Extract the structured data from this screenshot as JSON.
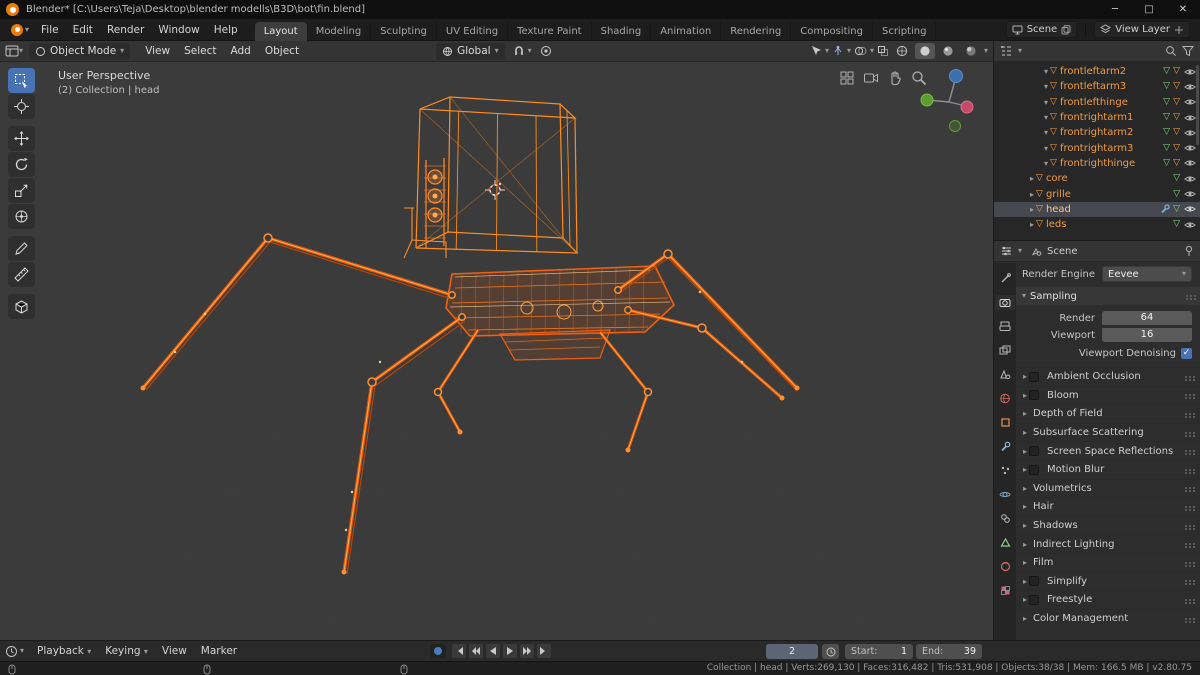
{
  "colors": {
    "accent_blue": "#4772b3",
    "selection_orange": "#f09a45",
    "wire_orange": "#ea5a08",
    "header_gray": "#343434"
  },
  "titlebar": {
    "title": "Blender* [C:\\Users\\Teja\\Desktop\\blender modells\\B3D\\bot\\fin.blend]"
  },
  "topbar": {
    "menus": [
      "File",
      "Edit",
      "Render",
      "Window",
      "Help"
    ],
    "workspaces": [
      "Layout",
      "Modeling",
      "Sculpting",
      "UV Editing",
      "Texture Paint",
      "Shading",
      "Animation",
      "Rendering",
      "Compositing",
      "Scripting"
    ],
    "active_workspace": "Layout",
    "scene_selector": {
      "label": "Scene"
    },
    "view_layer_selector": {
      "label": "View Layer"
    }
  },
  "viewport": {
    "header": {
      "mode": "Object Mode",
      "menus": [
        "View",
        "Select",
        "Add",
        "Object"
      ],
      "orientation": "Global"
    },
    "overlay": {
      "line1": "User Perspective",
      "line2": "(2) Collection | head"
    }
  },
  "toolbar": {
    "tools": [
      "select-box",
      "cursor",
      "move",
      "rotate",
      "scale",
      "transform",
      "annotate",
      "measure",
      "add-cube"
    ],
    "active_tool": "select-box"
  },
  "outliner": {
    "items": [
      {
        "name": "frontleftarm2",
        "indent": 2,
        "selected": true
      },
      {
        "name": "frontleftarm3",
        "indent": 2,
        "selected": true
      },
      {
        "name": "frontlefthinge",
        "indent": 2,
        "selected": true
      },
      {
        "name": "frontrightarm1",
        "indent": 2,
        "selected": true
      },
      {
        "name": "frontrightarm2",
        "indent": 2,
        "selected": true
      },
      {
        "name": "frontrightarm3",
        "indent": 2,
        "selected": true
      },
      {
        "name": "frontrighthinge",
        "indent": 2,
        "selected": true
      },
      {
        "name": "core",
        "indent": 1,
        "selected": true
      },
      {
        "name": "grille",
        "indent": 1,
        "selected": true
      },
      {
        "name": "head",
        "indent": 1,
        "selected": true,
        "active": true
      },
      {
        "name": "leds",
        "indent": 1,
        "selected": true
      }
    ]
  },
  "properties": {
    "breadcrumb": "Scene",
    "active_tab": "render",
    "tab_icons": [
      "active-tool",
      "render",
      "output",
      "view-layer",
      "scene",
      "world",
      "object",
      "modifiers",
      "particles",
      "physics",
      "constraints",
      "object-data",
      "material",
      "texture"
    ],
    "render_engine_label": "Render Engine",
    "render_engine": "Eevee",
    "sampling": {
      "title": "Sampling",
      "render_label": "Render",
      "render_value": "64",
      "viewport_label": "Viewport",
      "viewport_value": "16",
      "denoising_label": "Viewport Denoising",
      "denoising_checked": true
    },
    "sections": [
      {
        "label": "Ambient Occlusion",
        "checkbox": true,
        "checked": false
      },
      {
        "label": "Bloom",
        "checkbox": true,
        "checked": false
      },
      {
        "label": "Depth of Field",
        "checkbox": false
      },
      {
        "label": "Subsurface Scattering",
        "checkbox": false
      },
      {
        "label": "Screen Space Reflections",
        "checkbox": true,
        "checked": false
      },
      {
        "label": "Motion Blur",
        "checkbox": true,
        "checked": false
      },
      {
        "label": "Volumetrics",
        "checkbox": false
      },
      {
        "label": "Hair",
        "checkbox": false
      },
      {
        "label": "Shadows",
        "checkbox": false
      },
      {
        "label": "Indirect Lighting",
        "checkbox": false
      },
      {
        "label": "Film",
        "checkbox": false
      },
      {
        "label": "Simplify",
        "checkbox": true,
        "checked": false
      },
      {
        "label": "Freestyle",
        "checkbox": true,
        "checked": false
      },
      {
        "label": "Color Management",
        "checkbox": false
      }
    ]
  },
  "timeline": {
    "menus": [
      "Playback",
      "Keying",
      "View",
      "Marker"
    ],
    "current_frame": "2",
    "start_label": "Start:",
    "start_value": "1",
    "end_label": "End:",
    "end_value": "39"
  },
  "statusbar": {
    "info": "Collection | head | Verts:269,130 | Faces:316,482 | Tris:531,908 | Objects:38/38 | Mem: 166.5 MB | v2.80.75"
  },
  "icons": {
    "search-icon": "magnifier",
    "funnel-icon": "filter funnel",
    "pin-icon": "pin",
    "eye-icon": "visibility eye",
    "magnet-icon": "snapping magnet",
    "globe-icon": "orientation globe",
    "clock-icon": "timeline clock",
    "wrench-icon": "modifier wrench",
    "mesh-triangle-icon": "▽"
  }
}
